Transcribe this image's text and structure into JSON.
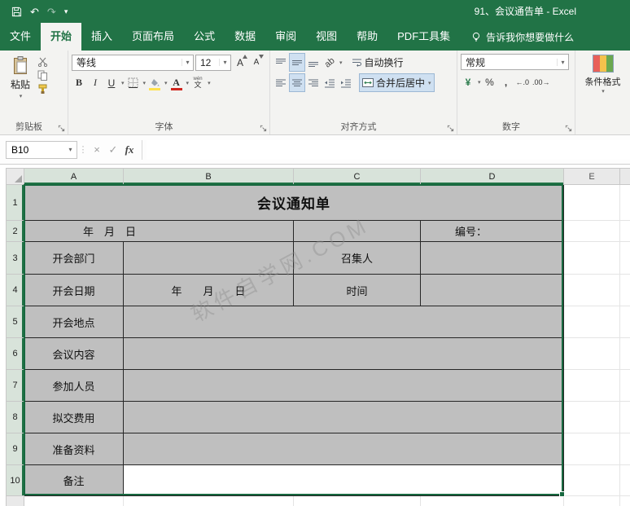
{
  "colors": {
    "excel_green": "#217346",
    "cell_gray": "#bfbfbf",
    "selection_border": "#17683f"
  },
  "titlebar": {
    "title": "91、会议通告单 - Excel"
  },
  "ribbon": {
    "tabs": [
      "文件",
      "开始",
      "插入",
      "页面布局",
      "公式",
      "数据",
      "审阅",
      "视图",
      "帮助",
      "PDF工具集"
    ],
    "active_tab": "开始",
    "tell_me": "告诉我你想要做什么",
    "clipboard": {
      "paste": "粘贴",
      "label": "剪贴板"
    },
    "font": {
      "name": "等线",
      "size": "12",
      "bold": "B",
      "italic": "I",
      "underline": "U",
      "phonetic_top": "wén",
      "phonetic_bottom": "文",
      "label": "字体"
    },
    "alignment": {
      "orientation": "ab",
      "wrap": "自动换行",
      "merge": "合并后居中",
      "label": "对齐方式"
    },
    "number": {
      "format": "常规",
      "currency": "¥",
      "percent": "%",
      "comma": ",",
      "inc_decimal": "←.0",
      "dec_decimal": ".00→",
      "label": "数字"
    },
    "styles": {
      "conditional": "条件格式"
    }
  },
  "formula_bar": {
    "name_box": "B10",
    "cancel": "×",
    "enter": "✓",
    "fx": "fx",
    "value": ""
  },
  "grid": {
    "columns": [
      "A",
      "B",
      "C",
      "D",
      "E"
    ],
    "rows": [
      "1",
      "2",
      "3",
      "4",
      "5",
      "6",
      "7",
      "8",
      "9",
      "10"
    ]
  },
  "form": {
    "title": "会议通知单",
    "date_line": "年　月　日",
    "number_label": "编号：",
    "dept_label": "开会部门",
    "convener_label": "召集人",
    "date_label": "开会日期",
    "date_value": "年　　月　　日",
    "time_label": "时间",
    "place_label": "开会地点",
    "content_label": "会议内容",
    "attendees_label": "参加人员",
    "fee_label": "拟交费用",
    "materials_label": "准备资料",
    "remark_label": "备注"
  },
  "watermark": {
    "text": "软件自学网.COM"
  },
  "icons": {
    "dropdown": "▾",
    "undo": "↶",
    "redo": "↷",
    "grip": "⋮",
    "grow_font": "A",
    "shrink_font": "A"
  }
}
